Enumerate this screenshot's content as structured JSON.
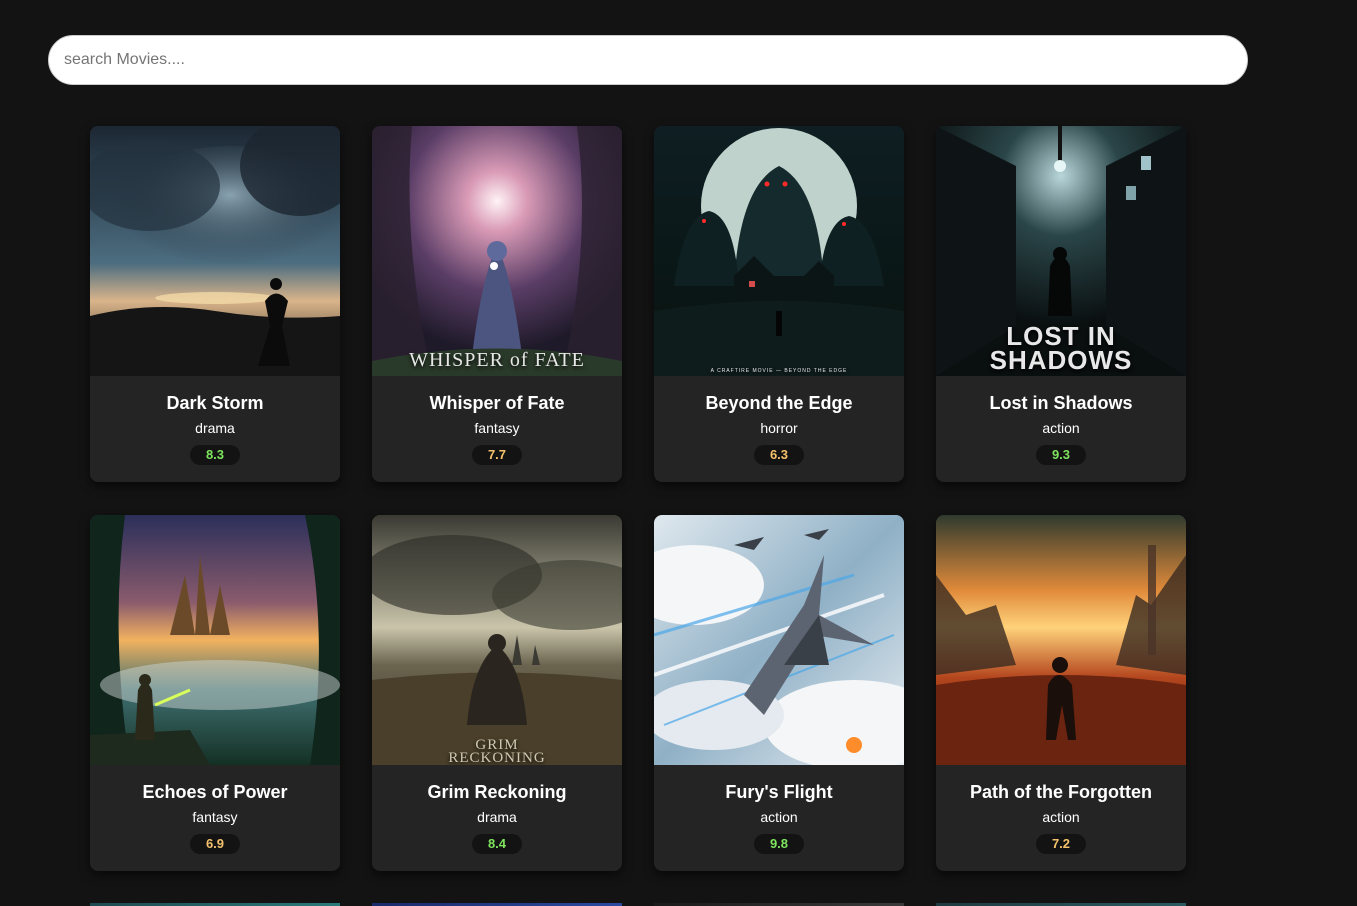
{
  "search": {
    "placeholder": "search Movies...."
  },
  "colors": {
    "background": "#131313",
    "card": "#242424",
    "rating_high": "#7ee35e",
    "rating_mid": "#f5c26b"
  },
  "movies": [
    {
      "title": "Dark Storm",
      "genre": "drama",
      "rating": "8.3",
      "rating_color": "#7ee35e",
      "poster_text": ""
    },
    {
      "title": "Whisper of Fate",
      "genre": "fantasy",
      "rating": "7.7",
      "rating_color": "#f5c26b",
      "poster_text": "WHISPER of FATE"
    },
    {
      "title": "Beyond the Edge",
      "genre": "horror",
      "rating": "6.3",
      "rating_color": "#f5c26b",
      "poster_text": "A CRAFTIRE MOVIE — BEYOND THE EDGE"
    },
    {
      "title": "Lost in Shadows",
      "genre": "action",
      "rating": "9.3",
      "rating_color": "#7ee35e",
      "poster_text": "LOST IN SHADOWS"
    },
    {
      "title": "Echoes of Power",
      "genre": "fantasy",
      "rating": "6.9",
      "rating_color": "#f5c26b",
      "poster_text": ""
    },
    {
      "title": "Grim Reckoning",
      "genre": "drama",
      "rating": "8.4",
      "rating_color": "#7ee35e",
      "poster_text": "GRIM RECKONING"
    },
    {
      "title": "Fury's Flight",
      "genre": "action",
      "rating": "9.8",
      "rating_color": "#7ee35e",
      "poster_text": ""
    },
    {
      "title": "Path of the Forgotten",
      "genre": "action",
      "rating": "7.2",
      "rating_color": "#f5c26b",
      "poster_text": ""
    }
  ]
}
